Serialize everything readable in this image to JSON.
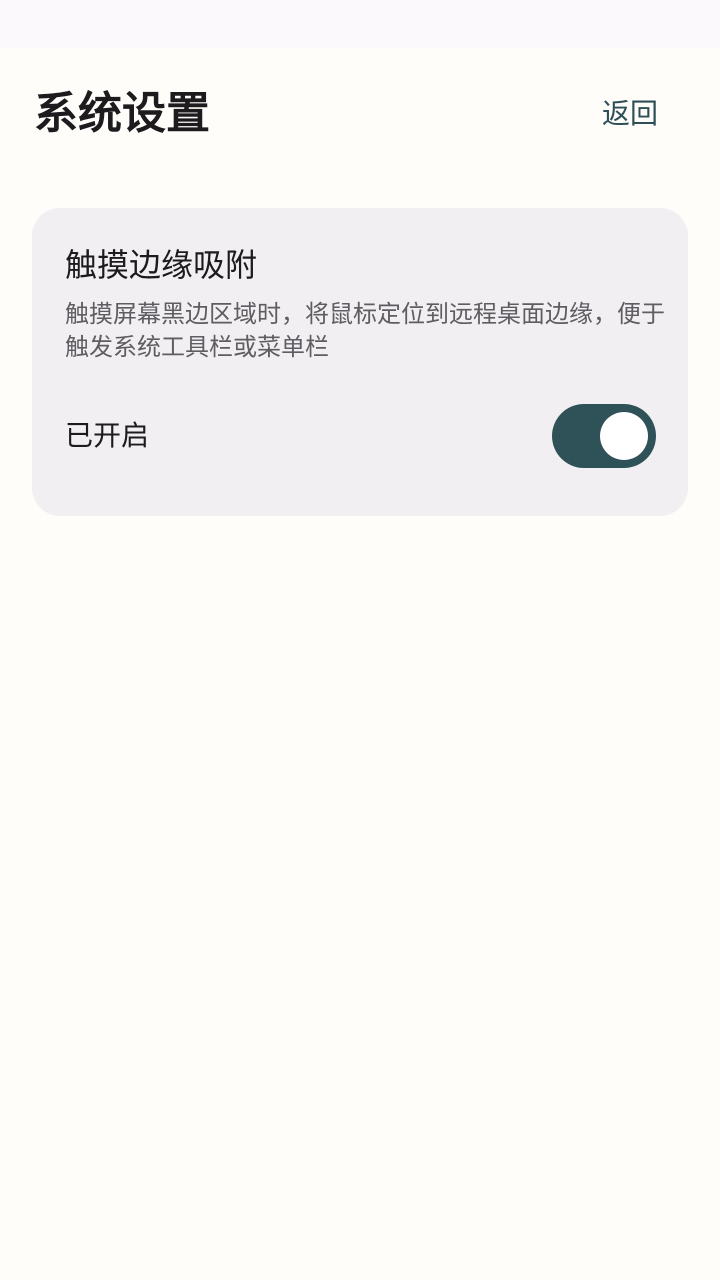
{
  "header": {
    "title": "系统设置",
    "back_label": "返回"
  },
  "setting": {
    "title": "触摸边缘吸附",
    "description": "触摸屏幕黑边区域时，将鼠标定位到远程桌面边缘，便于触发系统工具栏或菜单栏",
    "status_label": "已开启",
    "enabled": true
  },
  "colors": {
    "accent": "#2f5258",
    "background": "#fefdf9",
    "card": "#f2eff2"
  }
}
